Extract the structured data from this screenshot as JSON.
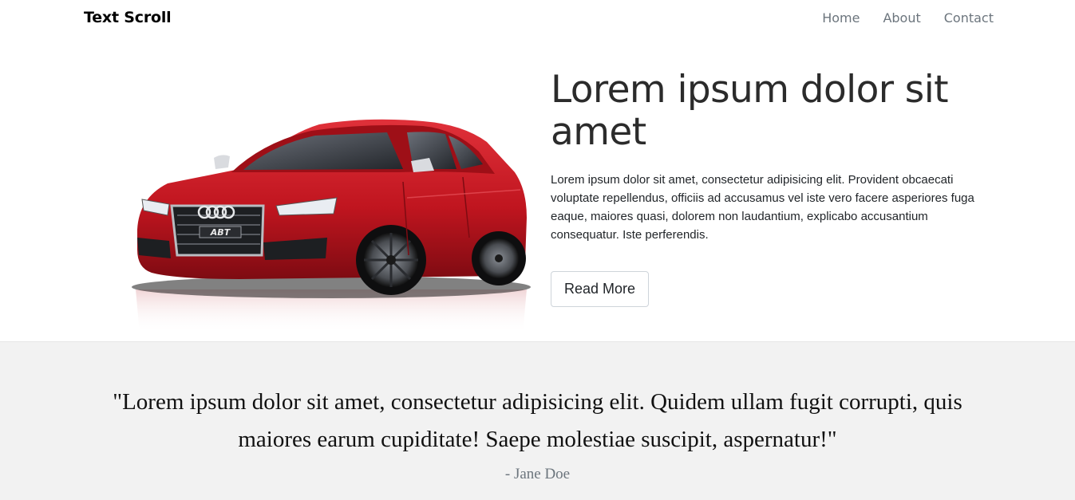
{
  "navbar": {
    "brand": "Text Scroll",
    "links": [
      "Home",
      "About",
      "Contact"
    ]
  },
  "hero": {
    "title": "Lorem ipsum dolor sit amet",
    "body": "Lorem ipsum dolor sit amet, consectetur adipisicing elit. Provident obcaecati voluptate repellendus, officiis ad accusamus vel iste vero facere asperiores fuga eaque, maiores quasi, dolorem non laudantium, explicabo accusantium consequatur. Iste perferendis.",
    "button_label": "Read More",
    "image": {
      "plate_text": "ABT",
      "car_color": "#c0151f"
    }
  },
  "testimonial": {
    "quote": "\"Lorem ipsum dolor sit amet, consectetur adipisicing elit. Quidem ullam fugit corrupti, quis maiores earum cupiditate! Saepe molestiae suscipit, aspernatur!\"",
    "author": "- Jane Doe"
  }
}
